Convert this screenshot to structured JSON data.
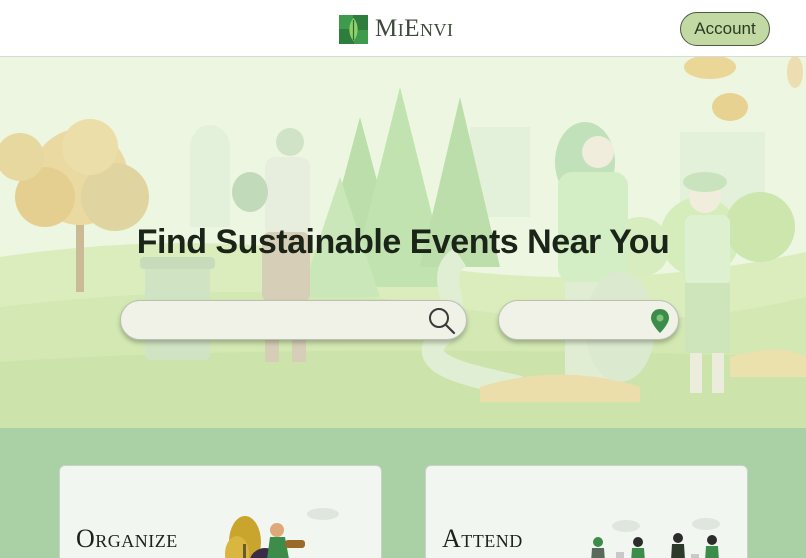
{
  "header": {
    "brand": "MiEnvi",
    "account_label": "Account"
  },
  "hero": {
    "title": "Find Sustainable Events Near You",
    "search_value": "",
    "location_value": ""
  },
  "cards": [
    {
      "title": "Organize"
    },
    {
      "title": "Attend"
    }
  ],
  "colors": {
    "accent": "#c2d9a4",
    "brand_green": "#3c8c4a",
    "section_bg": "#a9d1a5",
    "hero_bg": "#e8f3d8"
  },
  "icons": {
    "logo": "leaf-square-logo-icon",
    "search": "search-icon",
    "location": "location-pin-icon"
  }
}
